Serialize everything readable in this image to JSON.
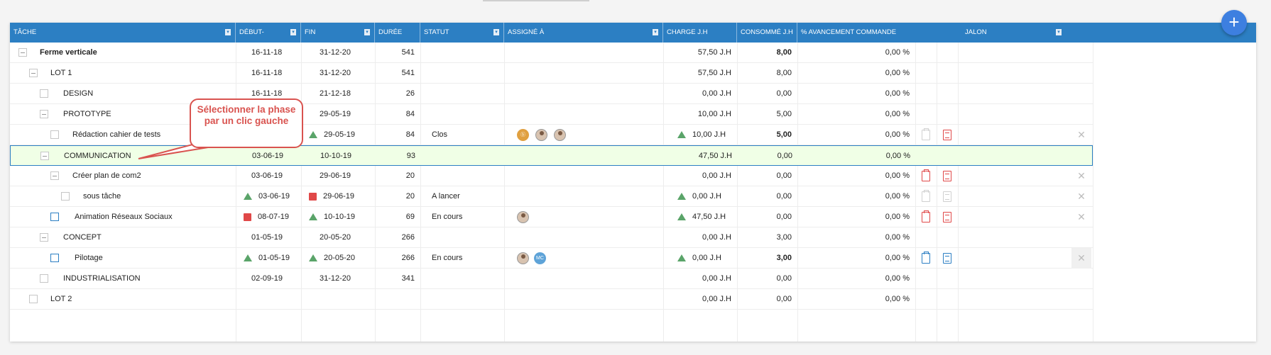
{
  "header": {
    "columns": [
      {
        "label": "TÂCHE",
        "filter": true
      },
      {
        "label": "DÉBUT-",
        "filter": true
      },
      {
        "label": "FIN",
        "filter": true
      },
      {
        "label": "DURÉE",
        "filter": false
      },
      {
        "label": "STATUT",
        "filter": true
      },
      {
        "label": "ASSIGNÉ À",
        "filter": true
      },
      {
        "label": "CHARGE J.H",
        "filter": false
      },
      {
        "label": "CONSOMMÉ J.H",
        "filter": false
      },
      {
        "label": "% AVANCEMENT COMMANDE",
        "filter": false
      },
      {
        "label": "JALON",
        "filter": true
      }
    ]
  },
  "callout": {
    "text": "Sélectionner la phase par un clic gauche"
  },
  "add_button": {
    "label": "+"
  },
  "rows": [
    {
      "task": "Ferme verticale",
      "start": "16-11-18",
      "end": "31-12-20",
      "duration": "541",
      "status": "",
      "charge": "57,50 J.H",
      "consumed": "8,00",
      "progress": "0,00 %"
    },
    {
      "task": "LOT 1",
      "start": "16-11-18",
      "end": "31-12-20",
      "duration": "541",
      "status": "",
      "charge": "57,50 J.H",
      "consumed": "8,00",
      "progress": "0,00 %"
    },
    {
      "task": "DESIGN",
      "start": "16-11-18",
      "end": "21-12-18",
      "duration": "26",
      "status": "",
      "charge": "0,00 J.H",
      "consumed": "0,00",
      "progress": "0,00 %"
    },
    {
      "task": "PROTOTYPE",
      "start": "",
      "end": "29-05-19",
      "duration": "84",
      "status": "",
      "charge": "10,00 J.H",
      "consumed": "5,00",
      "progress": "0,00 %"
    },
    {
      "task": "Rédaction cahier de tests",
      "start": "",
      "end": "29-05-19",
      "duration": "84",
      "status": "Clos",
      "charge": "10,00 J.H",
      "consumed": "5,00",
      "progress": "0,00 %"
    },
    {
      "task": "COMMUNICATION",
      "start": "03-06-19",
      "end": "10-10-19",
      "duration": "93",
      "status": "",
      "charge": "47,50 J.H",
      "consumed": "0,00",
      "progress": "0,00 %"
    },
    {
      "task": "Créer plan de com2",
      "start": "03-06-19",
      "end": "29-06-19",
      "duration": "20",
      "status": "",
      "charge": "0,00 J.H",
      "consumed": "0,00",
      "progress": "0,00 %"
    },
    {
      "task": "sous tâche",
      "start": "03-06-19",
      "end": "29-06-19",
      "duration": "20",
      "status": "A lancer",
      "charge": "0,00 J.H",
      "consumed": "0,00",
      "progress": "0,00 %"
    },
    {
      "task": "Animation Réseaux Sociaux",
      "start": "08-07-19",
      "end": "10-10-19",
      "duration": "69",
      "status": "En cours",
      "charge": "47,50 J.H",
      "consumed": "0,00",
      "progress": "0,00 %"
    },
    {
      "task": "CONCEPT",
      "start": "01-05-19",
      "end": "20-05-20",
      "duration": "266",
      "status": "",
      "charge": "0,00 J.H",
      "consumed": "3,00",
      "progress": "0,00 %"
    },
    {
      "task": "Pilotage",
      "start": "01-05-19",
      "end": "20-05-20",
      "duration": "266",
      "status": "En cours",
      "charge": "0,00 J.H",
      "consumed": "3,00",
      "progress": "0,00 %"
    },
    {
      "task": "INDUSTRIALISATION",
      "start": "02-09-19",
      "end": "31-12-20",
      "duration": "341",
      "status": "",
      "charge": "0,00 J.H",
      "consumed": "0,00",
      "progress": "0,00 %"
    },
    {
      "task": "LOT 2",
      "start": "",
      "end": "",
      "duration": "",
      "status": "",
      "charge": "0,00 J.H",
      "consumed": "0,00",
      "progress": "0,00 %"
    }
  ],
  "avatars": {
    "mc_initials": "MC"
  },
  "colors": {
    "header": "#2c7fc3",
    "selected_row": "#f0ffe6",
    "late": "#e04848",
    "on_time": "#5aa469",
    "callout": "#d9534f"
  }
}
